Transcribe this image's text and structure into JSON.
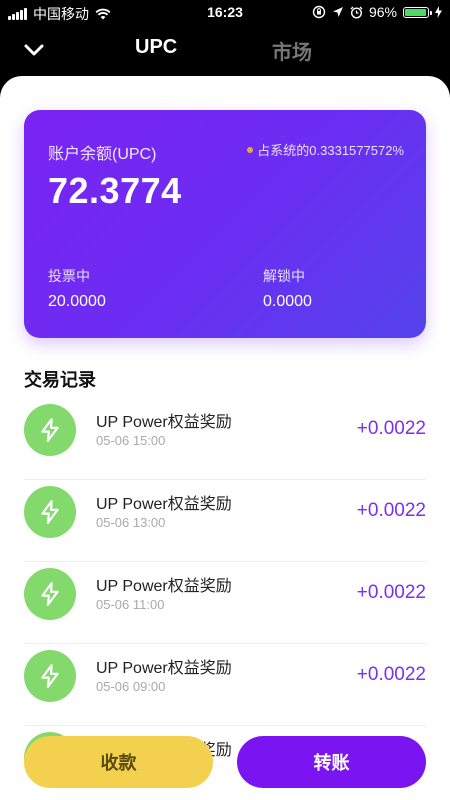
{
  "status_bar": {
    "carrier": "中国移动",
    "time": "16:23",
    "battery": "96%",
    "battery_level": 0.96,
    "icons": [
      "signal-icon",
      "wifi-icon",
      "lock-rotation-icon",
      "location-icon",
      "alarm-icon",
      "battery-icon",
      "charging-icon"
    ]
  },
  "nav": {
    "tabs": [
      "UPC",
      "市场"
    ],
    "active_tab": "UPC",
    "back_icon": "chevron-down-icon"
  },
  "card": {
    "balance_label": "账户余额(UPC)",
    "share_text": "占系统的0.3331577572%",
    "balance": "72.3774",
    "voting_label": "投票中",
    "voting_value": "20.0000",
    "unlocking_label": "解锁中",
    "unlocking_value": "0.0000",
    "gradient_colors": [
      "#7a23f3",
      "#5543ec"
    ],
    "dot_color": "#f5c518"
  },
  "transactions": {
    "title": "交易记录",
    "items": [
      {
        "title": "UP Power权益奖励",
        "time": "05-06 15:00",
        "amount": "+0.0022"
      },
      {
        "title": "UP Power权益奖励",
        "time": "05-06 13:00",
        "amount": "+0.0022"
      },
      {
        "title": "UP Power权益奖励",
        "time": "05-06 11:00",
        "amount": "+0.0022"
      },
      {
        "title": "UP Power权益奖励",
        "time": "05-06 09:00",
        "amount": "+0.0022"
      },
      {
        "title": "UP Power权益奖励",
        "time": "",
        "amount": ""
      }
    ],
    "icon": "lightning-icon",
    "icon_bg": "#84d96c",
    "amount_color": "#7b2ff0"
  },
  "actions": {
    "receive_label": "收款",
    "transfer_label": "转账",
    "receive_color": "#f3d14f",
    "transfer_color": "#7a15f2"
  }
}
